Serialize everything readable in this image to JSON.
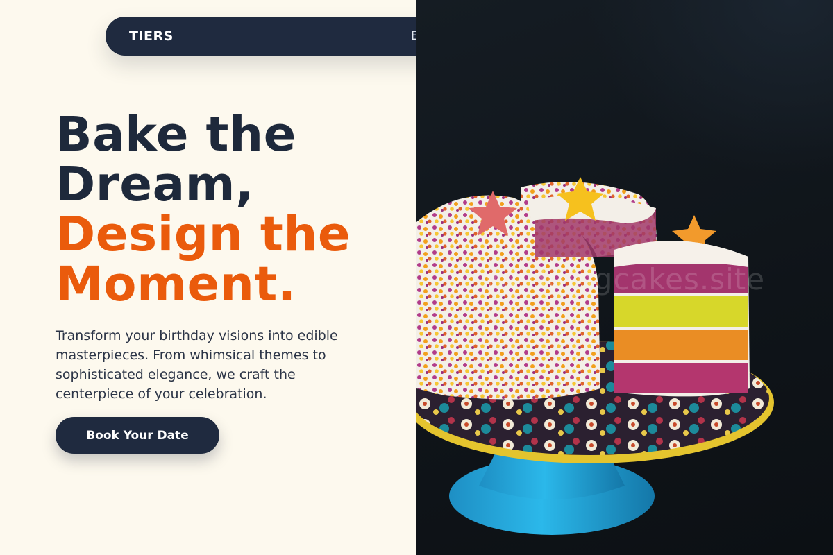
{
  "nav": {
    "brand": "TIERS",
    "link_partial": "E"
  },
  "hero": {
    "headline_line1": "Bake the",
    "headline_line2": "Dream,",
    "headline_line3": "Design the",
    "headline_line4": "Moment.",
    "lead": "Transform your birthday visions into edible masterpieces. From whimsical themes to sophisticated elegance, we craft the centerpiece of your celebration.",
    "cta_label": "Book Your Date"
  },
  "photo": {
    "description_icon": "layered-birthday-cake-photo",
    "watermark": "weddingcakes.site"
  },
  "colors": {
    "navy": "#1e293b",
    "accent": "#ea5b0c",
    "cream": "#fdf9ee"
  }
}
